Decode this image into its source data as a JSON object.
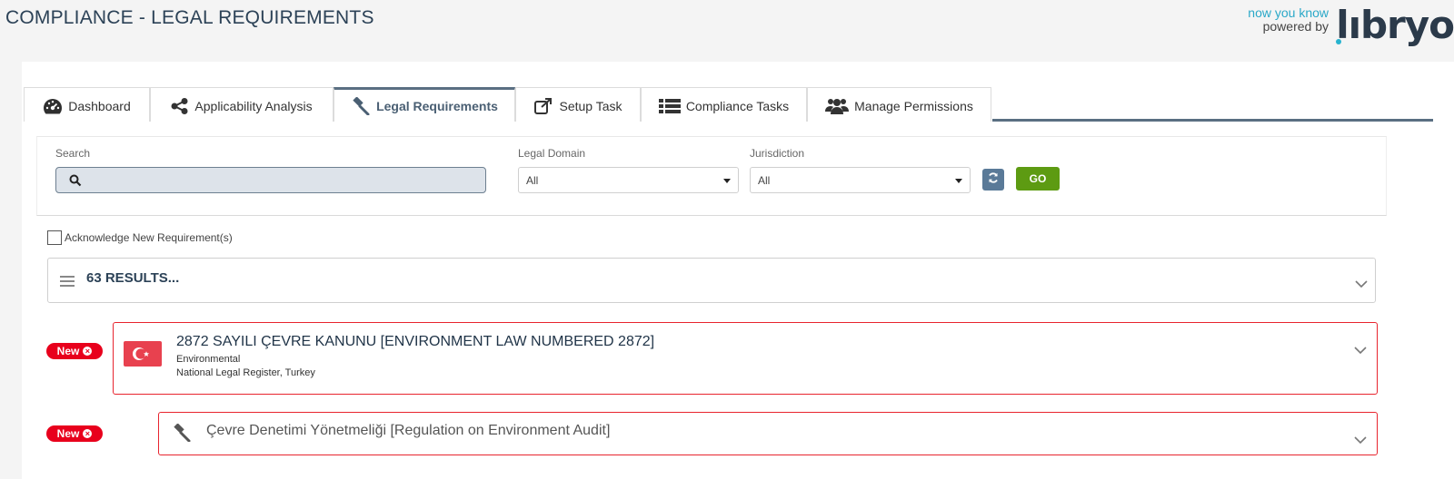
{
  "page": {
    "title": "COMPLIANCE - LEGAL REQUIREMENTS"
  },
  "brand": {
    "tagline_line1": "now you know",
    "tagline_line2": "powered by",
    "logo_text": "lıbryo"
  },
  "tabs": [
    {
      "label": "Dashboard",
      "icon": "dashboard-icon",
      "active": false
    },
    {
      "label": "Applicability Analysis",
      "icon": "share-icon",
      "active": false
    },
    {
      "label": "Legal Requirements",
      "icon": "gavel-icon",
      "active": true
    },
    {
      "label": "Setup Task",
      "icon": "external-link-icon",
      "active": false
    },
    {
      "label": "Compliance Tasks",
      "icon": "list-icon",
      "active": false
    },
    {
      "label": "Manage Permissions",
      "icon": "users-icon",
      "active": false
    }
  ],
  "filters": {
    "search_label": "Search",
    "search_value": "",
    "legal_domain_label": "Legal Domain",
    "legal_domain_value": "All",
    "jurisdiction_label": "Jurisdiction",
    "jurisdiction_value": "All",
    "go_label": "GO"
  },
  "acknowledge": {
    "label": "Acknowledge New Requirement(s)",
    "checked": false
  },
  "results": {
    "label": "63 RESULTS..."
  },
  "items": [
    {
      "badge": "New",
      "flag_country": "Turkey",
      "title": "2872 SAYILI ÇEVRE KANUNU [ENVIRONMENT LAW NUMBERED 2872]",
      "domain": "Environmental",
      "source": "National Legal Register, Turkey"
    },
    {
      "badge": "New",
      "icon": "gavel-icon",
      "title": "Çevre Denetimi Yönetmeliği [Regulation on Environment Audit]"
    }
  ],
  "colors": {
    "accent": "#5a6f82",
    "go_green": "#5d9b12",
    "new_red": "#e8001c",
    "card_border_red": "#e8242e",
    "title_navy": "#2c4257"
  }
}
